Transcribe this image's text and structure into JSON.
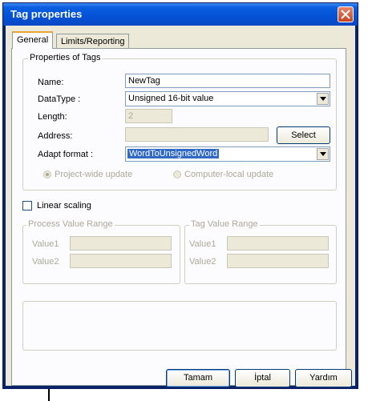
{
  "window": {
    "title": "Tag properties"
  },
  "tabs": [
    {
      "label": "General"
    },
    {
      "label": "Limits/Reporting"
    }
  ],
  "properties_group": {
    "legend": "Properties of Tags",
    "name_label": "Name:",
    "name_value": "NewTag",
    "datatype_label": "DataType :",
    "datatype_value": "Unsigned 16-bit value",
    "length_label": "Length:",
    "length_value": "2",
    "address_label": "Address:",
    "address_value": "",
    "select_button": "Select",
    "adapt_label": "Adapt format :",
    "adapt_value": "WordToUnsignedWord",
    "radio_project": "Project-wide update",
    "radio_computer": "Computer-local update"
  },
  "linear_scaling": {
    "label": "Linear scaling",
    "checked": false
  },
  "process_range": {
    "legend": "Process Value Range",
    "value1_label": "Value1",
    "value2_label": "Value2"
  },
  "tag_range": {
    "legend": "Tag Value Range",
    "value1_label": "Value1",
    "value2_label": "Value2"
  },
  "buttons": {
    "ok": "Tamam",
    "cancel": "İptal",
    "help": "Yardım"
  },
  "colors": {
    "title_bar": "#0451d6",
    "dialog_bg": "#ece9d8",
    "selection": "#316ac5",
    "close_button": "#d9572e"
  },
  "icons": {
    "close": "close-icon",
    "dropdown": "chevron-down-icon"
  }
}
